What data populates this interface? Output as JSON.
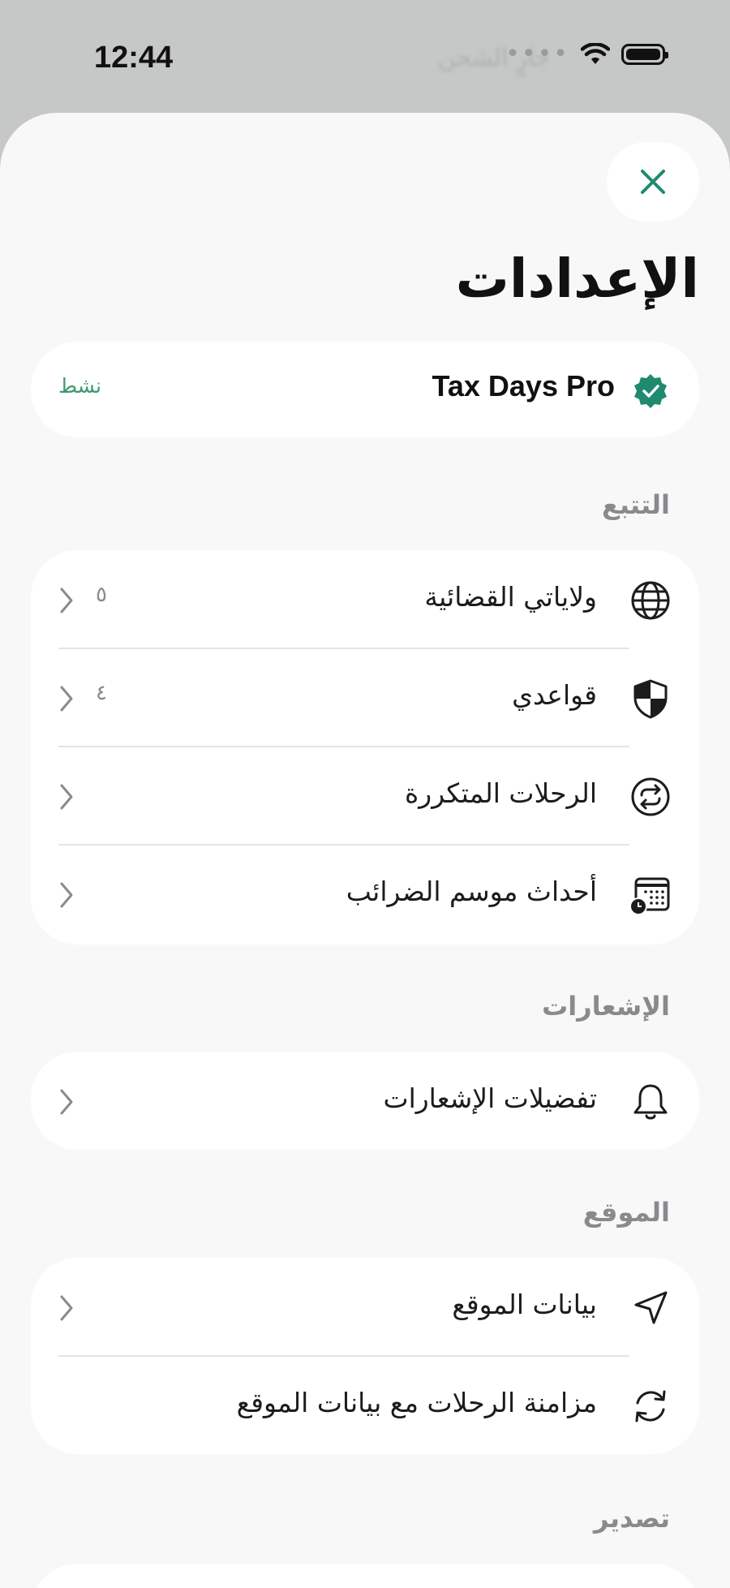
{
  "status_bar": {
    "time": "12:44",
    "carrier_ghost": "جارٍ الشحن",
    "signal_dots": "••••"
  },
  "sheet": {
    "title": "الإعدادات",
    "close_icon": "close-icon",
    "accent_color": "#1f8a6f"
  },
  "subscription": {
    "name": "Tax Days Pro",
    "status": "نشط",
    "badge_icon": "verified-badge-icon"
  },
  "sections": {
    "tracking": {
      "header": "التتبع",
      "items": [
        {
          "label": "ولاياتي القضائية",
          "value": "٥",
          "icon": "globe-icon"
        },
        {
          "label": "قواعدي",
          "value": "٤",
          "icon": "shield-icon"
        },
        {
          "label": "الرحلات المتكررة",
          "value": "",
          "icon": "repeat-icon"
        },
        {
          "label": "أحداث موسم الضرائب",
          "value": "",
          "icon": "calendar-clock-icon"
        }
      ]
    },
    "notifications": {
      "header": "الإشعارات",
      "items": [
        {
          "label": "تفضيلات الإشعارات",
          "icon": "bell-icon"
        }
      ]
    },
    "location": {
      "header": "الموقع",
      "items": [
        {
          "label": "بيانات الموقع",
          "icon": "location-arrow-icon"
        },
        {
          "label": "مزامنة الرحلات مع بيانات الموقع",
          "icon": "sync-icon"
        }
      ]
    },
    "export": {
      "header": "تصدير"
    }
  }
}
